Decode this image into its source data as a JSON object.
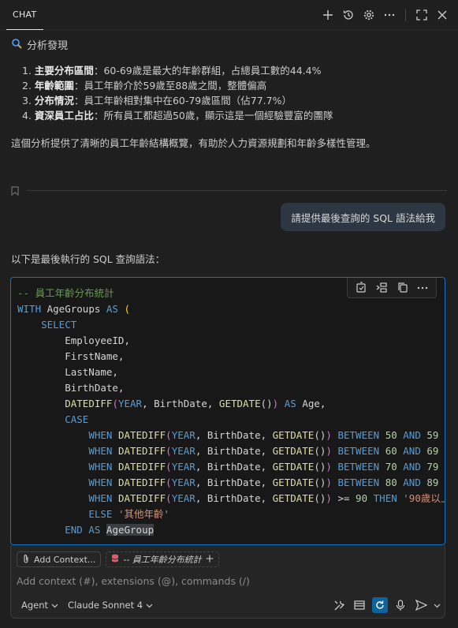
{
  "titlebar": {
    "tab_label": "CHAT"
  },
  "message": {
    "heading": "分析發現",
    "findings": [
      {
        "num": "1.",
        "label": "主要分布區間",
        "text": "：60-69歲是最大的年齡群組，占總員工數的44.4%"
      },
      {
        "num": "2.",
        "label": "年齡範圍",
        "text": "：員工年齡介於59歲至88歲之間，整體偏高"
      },
      {
        "num": "3.",
        "label": "分布情況",
        "text": "：員工年齡相對集中在60-79歲區間（佔77.7%）"
      },
      {
        "num": "4.",
        "label": "資深員工占比",
        "text": "：所有員工都超過50歲，顯示這是一個經驗豐富的團隊"
      }
    ],
    "summary": "這個分析提供了清晰的員工年齡結構概覽，有助於人力資源規劃和年齡多樣性管理。"
  },
  "user_message": "請提供最後查詢的 SQL 語法給我",
  "reply_intro": "以下是最後執行的 SQL 查詢語法：",
  "input": {
    "add_context_label": "Add Context...",
    "file_chip_label": "-- 員工年齡分布統計",
    "placeholder": "Add context (#), extensions (@), commands (/)",
    "mode": "Agent",
    "model": "Claude Sonnet 4"
  },
  "colors": {
    "accent": "#0e72c6",
    "comment": "#6a9955",
    "keyword": "#569cd6",
    "function": "#dcdcaa",
    "string": "#ce9178",
    "number": "#b5cea8"
  },
  "icons": [
    "sparkle-search-icon",
    "plus-icon",
    "history-icon",
    "gear-icon",
    "more-icon",
    "maximize-icon",
    "close-icon",
    "bookmark-icon",
    "apply-in-editor-icon",
    "insert-at-cursor-icon",
    "copy-icon",
    "paperclip-icon",
    "database-icon",
    "tools-icon",
    "sidebar-icon",
    "refresh-icon",
    "microphone-icon",
    "send-icon"
  ]
}
